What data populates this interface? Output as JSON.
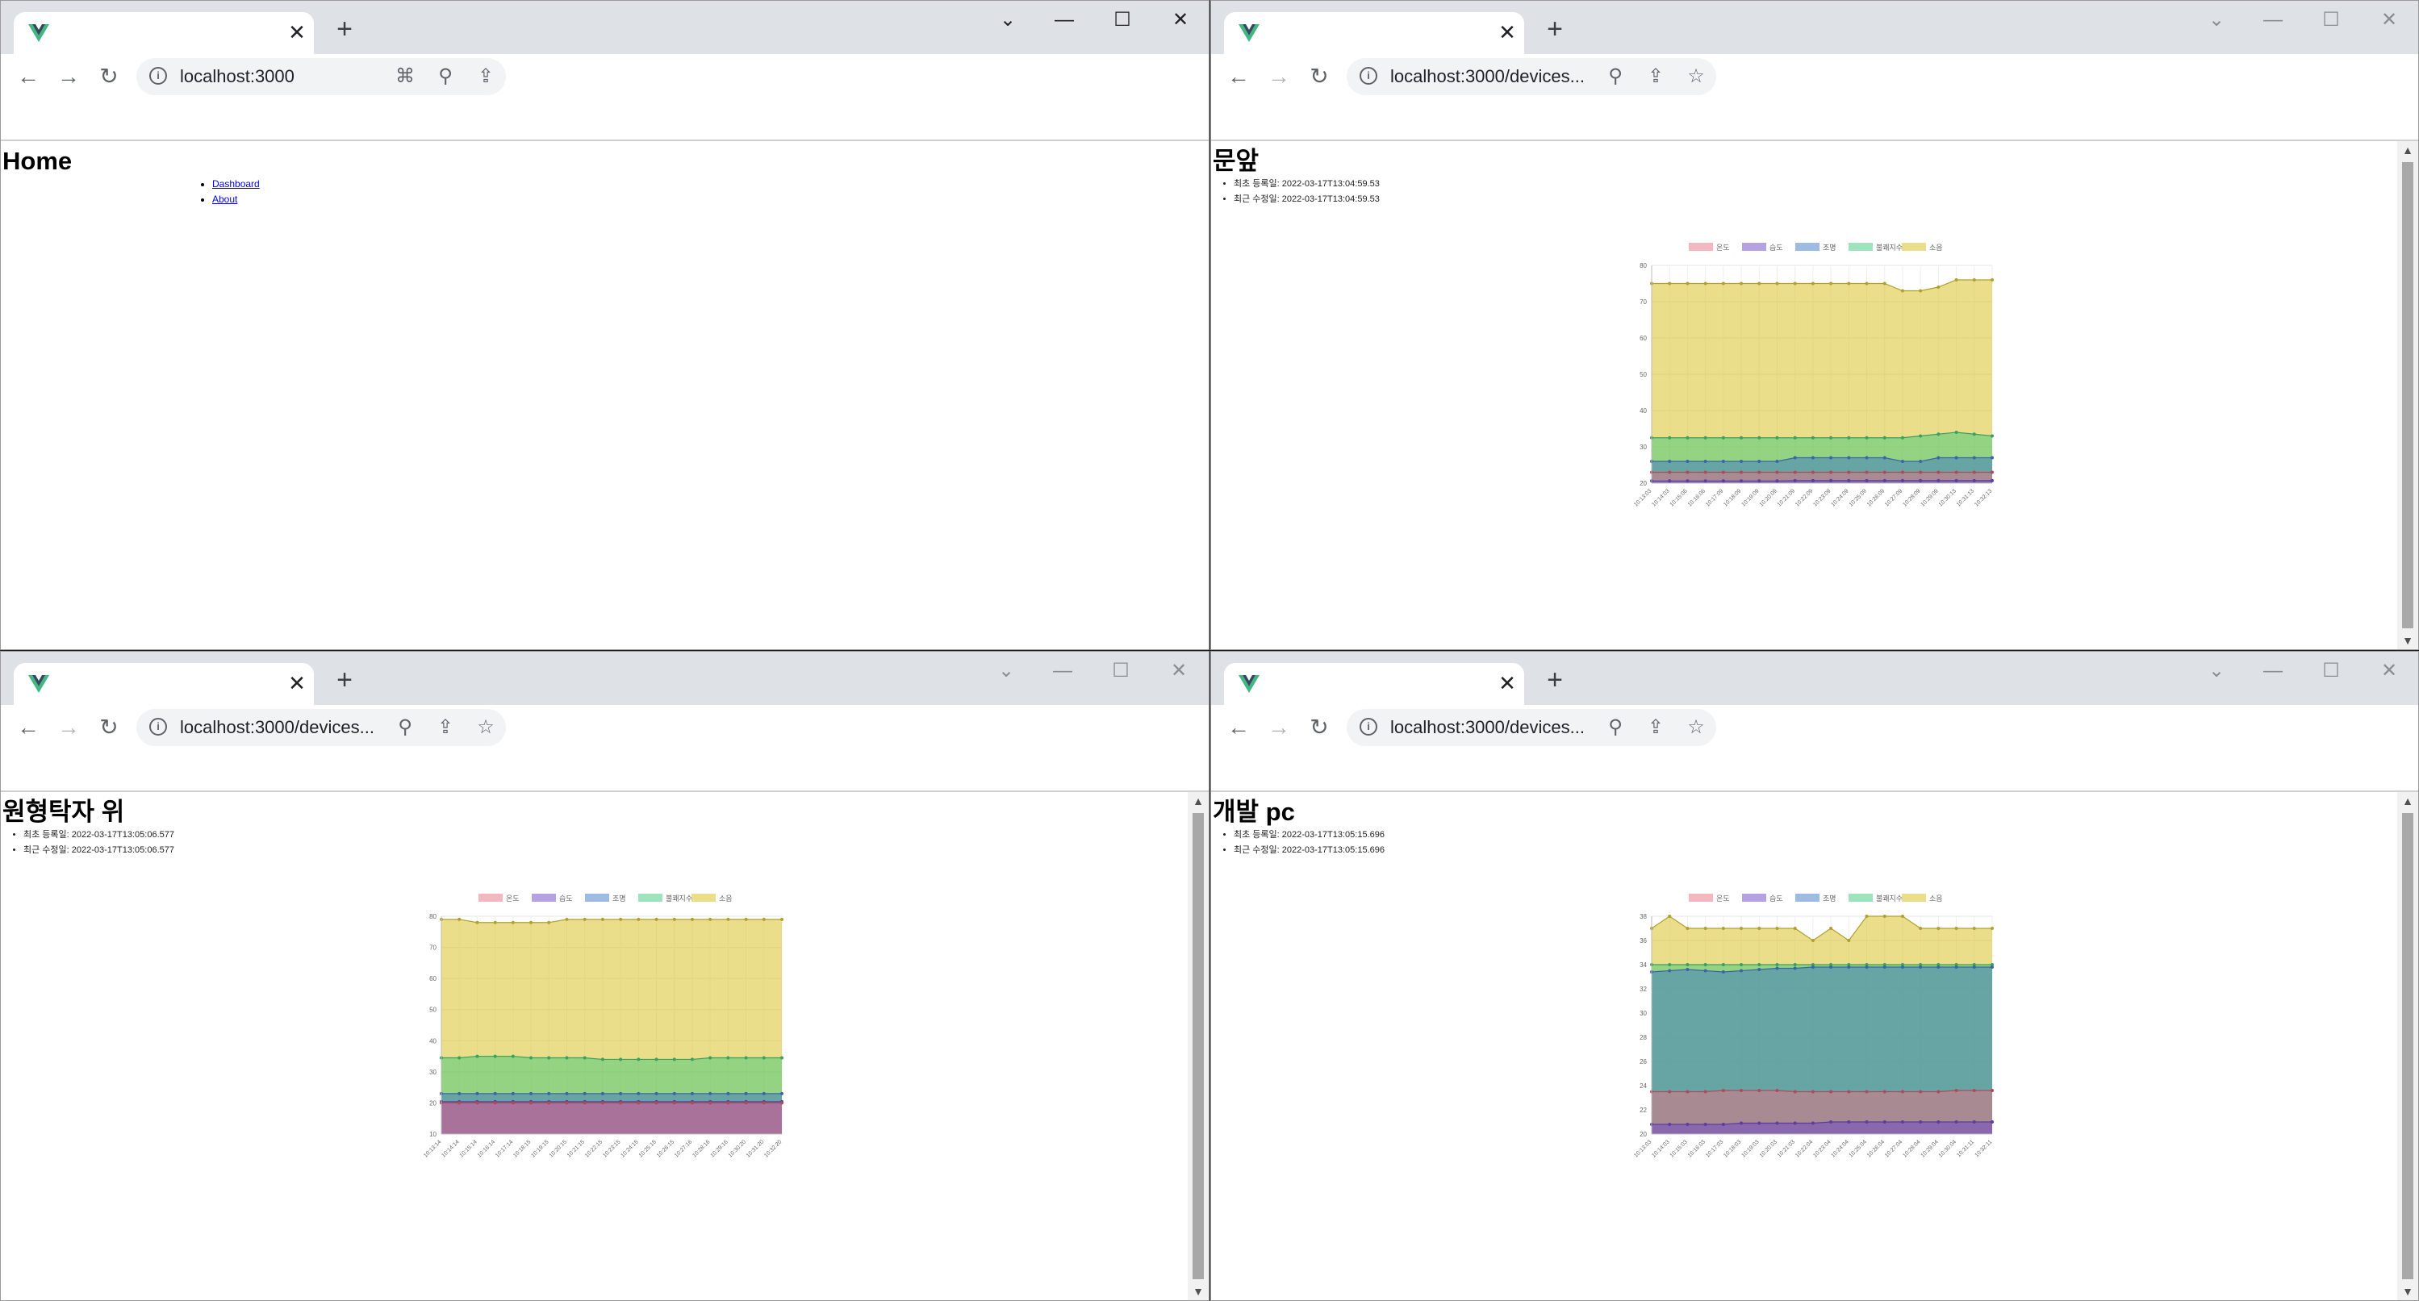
{
  "win0": {
    "url": "localhost:3000",
    "heading": "Home",
    "nav": [
      "Dashboard",
      "About"
    ]
  },
  "win1": {
    "url": "localhost:3000/devices...",
    "heading": "문앞",
    "meta": [
      "최초 등록일: 2022-03-17T13:04:59.53",
      "최근 수정일: 2022-03-17T13:04:59.53"
    ]
  },
  "win2": {
    "url": "localhost:3000/devices...",
    "heading": "원형탁자 위",
    "meta": [
      "최초 등록일: 2022-03-17T13:05:06.577",
      "최근 수정일: 2022-03-17T13:05:06.577"
    ]
  },
  "win3": {
    "url": "localhost:3000/devices...",
    "heading": "개발 pc",
    "meta": [
      "최초 등록일: 2022-03-17T13:05:15.696",
      "최근 수정일: 2022-03-17T13:05:15.696"
    ]
  },
  "colors": {
    "tab_strip": "#dee1e6",
    "vue_green": "#41b883",
    "vue_dark": "#35495e"
  },
  "chart_data": [
    {
      "type": "area",
      "stacked": false,
      "legend": [
        "온도",
        "습도",
        "조명",
        "불쾌지수",
        "소음"
      ],
      "legend_placement": "top",
      "x": [
        "10:13:03",
        "10:14:03",
        "10:15:06",
        "10:16:06",
        "10:17:09",
        "10:18:09",
        "10:19:09",
        "10:20:09",
        "10:21:09",
        "10:22:09",
        "10:23:09",
        "10:24:09",
        "10:25:09",
        "10:26:09",
        "10:27:09",
        "10:28:09",
        "10:29:09",
        "10:30:13",
        "10:31:13",
        "10:32:13"
      ],
      "xlabels": [
        "10:13:03",
        "10:14:03",
        "10:15:06",
        "10:16:06",
        "10:17:09",
        "10:18:09",
        "10:19:09",
        "10:20:09",
        "10:21:09",
        "10:22:09",
        "10:23:09",
        "10:24:09",
        "10:25:09",
        "10:26:09",
        "10:27:09",
        "10:28:09",
        "10:29:09",
        "10:30:13",
        "10:31:13",
        "10:32:13"
      ],
      "ylim": [
        20,
        80
      ],
      "yticks": [
        20,
        30,
        40,
        50,
        60,
        70,
        80
      ],
      "grid": true,
      "series": [
        {
          "name": "온도",
          "values": [
            23,
            23,
            23,
            23,
            23,
            23,
            23,
            23,
            23,
            23,
            23,
            23,
            23,
            23,
            23,
            23,
            23,
            23,
            23,
            23
          ]
        },
        {
          "name": "습도",
          "values": [
            20.6,
            20.6,
            20.6,
            20.6,
            20.6,
            20.6,
            20.6,
            20.6,
            20.7,
            20.7,
            20.7,
            20.7,
            20.7,
            20.7,
            20.7,
            20.7,
            20.7,
            20.7,
            20.7,
            20.7
          ]
        },
        {
          "name": "조명",
          "values": [
            26,
            26,
            26,
            26,
            26,
            26,
            26,
            26,
            27,
            27,
            27,
            27,
            27,
            27,
            26,
            26,
            27,
            27,
            27,
            27
          ]
        },
        {
          "name": "불쾌지수",
          "values": [
            32.5,
            32.5,
            32.5,
            32.5,
            32.5,
            32.5,
            32.5,
            32.5,
            32.5,
            32.5,
            32.5,
            32.5,
            32.5,
            32.5,
            32.5,
            33,
            33.5,
            34,
            33.5,
            33
          ]
        },
        {
          "name": "소음",
          "values": [
            75,
            75,
            75,
            75,
            75,
            75,
            75,
            75,
            75,
            75,
            75,
            75,
            75,
            75,
            73,
            73,
            74,
            76,
            76,
            76
          ]
        }
      ]
    },
    {
      "type": "area",
      "stacked": false,
      "legend": [
        "온도",
        "습도",
        "조명",
        "불쾌지수",
        "소음"
      ],
      "legend_placement": "top",
      "x": [
        "10:13:14",
        "10:14:14",
        "10:15:14",
        "10:16:14",
        "10:17:14",
        "10:18:15",
        "10:19:15",
        "10:20:15",
        "10:21:15",
        "10:22:15",
        "10:23:15",
        "10:24:15",
        "10:25:15",
        "10:26:15",
        "10:27:16",
        "10:28:16",
        "10:29:16",
        "10:30:20",
        "10:31:20",
        "10:32:20"
      ],
      "xlabels": [
        "10:13:14",
        "10:14:14",
        "10:15:14",
        "10:16:14",
        "10:17:14",
        "10:18:15",
        "10:19:15",
        "10:20:15",
        "10:21:15",
        "10:22:15",
        "10:23:15",
        "10:24:15",
        "10:25:15",
        "10:26:15",
        "10:27:16",
        "10:28:16",
        "10:29:16",
        "10:30:20",
        "10:31:20",
        "10:32:20"
      ],
      "ylim": [
        10,
        80
      ],
      "yticks": [
        10,
        20,
        30,
        40,
        50,
        60,
        70,
        80
      ],
      "grid": true,
      "series": [
        {
          "name": "온도",
          "values": [
            20,
            20,
            20,
            20,
            20,
            20,
            20,
            20,
            20,
            20,
            20,
            20,
            20,
            20,
            20,
            20,
            20,
            20,
            20,
            20
          ]
        },
        {
          "name": "습도",
          "values": [
            20.4,
            20.4,
            20.4,
            20.4,
            20.4,
            20.4,
            20.4,
            20.4,
            20.4,
            20.4,
            20.4,
            20.4,
            20.4,
            20.4,
            20.4,
            20.4,
            20.4,
            20.4,
            20.4,
            20.4
          ]
        },
        {
          "name": "조명",
          "values": [
            23,
            23,
            23,
            23,
            23,
            23,
            23,
            23,
            23,
            23,
            23,
            23,
            23,
            23,
            23,
            23,
            23,
            23,
            23,
            23
          ]
        },
        {
          "name": "불쾌지수",
          "values": [
            34.5,
            34.5,
            35,
            35,
            35,
            34.5,
            34.5,
            34.5,
            34.5,
            34,
            34,
            34,
            34,
            34,
            34,
            34.5,
            34.5,
            34.5,
            34.5,
            34.5
          ]
        },
        {
          "name": "소음",
          "values": [
            79,
            79,
            78,
            78,
            78,
            78,
            78,
            79,
            79,
            79,
            79,
            79,
            79,
            79,
            79,
            79,
            79,
            79,
            79,
            79
          ]
        }
      ]
    },
    {
      "type": "area",
      "stacked": false,
      "legend": [
        "온도",
        "습도",
        "조명",
        "불쾌지수",
        "소음"
      ],
      "legend_placement": "top",
      "x": [
        "10:13:03",
        "10:14:03",
        "10:15:03",
        "10:16:03",
        "10:17:03",
        "10:18:03",
        "10:19:03",
        "10:20:03",
        "10:21:03",
        "10:22:04",
        "10:23:04",
        "10:24:04",
        "10:25:04",
        "10:26:04",
        "10:27:04",
        "10:28:04",
        "10:29:04",
        "10:30:04",
        "10:31:11",
        "10:32:11"
      ],
      "xlabels": [
        "10:13:03",
        "10:14:03",
        "10:15:03",
        "10:16:03",
        "10:17:03",
        "10:18:03",
        "10:19:03",
        "10:20:03",
        "10:21:03",
        "10:22:04",
        "10:23:04",
        "10:24:04",
        "10:25:04",
        "10:26:04",
        "10:27:04",
        "10:28:04",
        "10:29:04",
        "10:30:04",
        "10:31:11",
        "10:32:11"
      ],
      "ylim": [
        20,
        38
      ],
      "yticks": [
        20,
        22,
        24,
        26,
        28,
        30,
        32,
        34,
        36,
        38
      ],
      "grid": true,
      "series": [
        {
          "name": "온도",
          "values": [
            23.5,
            23.5,
            23.5,
            23.5,
            23.6,
            23.6,
            23.6,
            23.6,
            23.5,
            23.5,
            23.5,
            23.5,
            23.5,
            23.5,
            23.5,
            23.5,
            23.5,
            23.6,
            23.6,
            23.6
          ]
        },
        {
          "name": "습도",
          "values": [
            20.8,
            20.8,
            20.8,
            20.8,
            20.8,
            20.9,
            20.9,
            20.9,
            20.9,
            20.9,
            21,
            21,
            21,
            21,
            21,
            21,
            21,
            21,
            21,
            21
          ]
        },
        {
          "name": "조명",
          "values": [
            33.4,
            33.5,
            33.6,
            33.5,
            33.4,
            33.5,
            33.6,
            33.7,
            33.7,
            33.8,
            33.8,
            33.8,
            33.8,
            33.8,
            33.8,
            33.8,
            33.8,
            33.8,
            33.8,
            33.8
          ]
        },
        {
          "name": "불쾌지수",
          "values": [
            34,
            34,
            34,
            34,
            34,
            34,
            34,
            34,
            34,
            34,
            34,
            34,
            34,
            34,
            34,
            34,
            34,
            34,
            34,
            34
          ]
        },
        {
          "name": "소음",
          "values": [
            37,
            38,
            37,
            37,
            37,
            37,
            37,
            37,
            37,
            36,
            37,
            36,
            38,
            38,
            38,
            37,
            37,
            37,
            37,
            37
          ]
        }
      ]
    }
  ]
}
